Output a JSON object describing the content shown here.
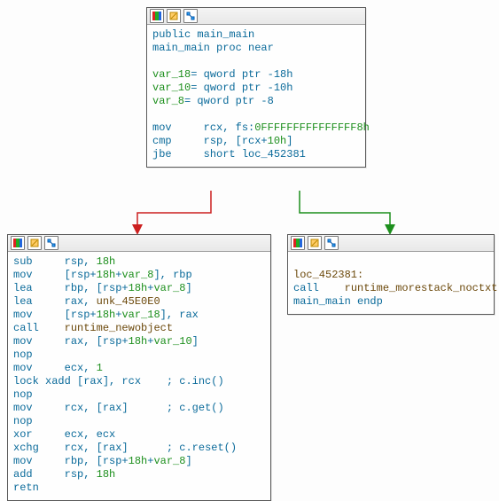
{
  "top_block": {
    "line1_public": "public",
    "line1_name": "main_main",
    "line2_name": "main_main",
    "line2_proc": "proc near",
    "var18_name": "var_18",
    "var18_eq": "= qword ptr -18h",
    "var10_name": "var_10",
    "var10_eq": "= qword ptr -10h",
    "var8_name": "var_8",
    "var8_eq": "= qword ptr -8",
    "mov": "mov",
    "mov_ops_a": "rcx, fs:",
    "mov_ops_b": "0FFFFFFFFFFFFFFF8h",
    "cmp": "cmp",
    "cmp_ops_a": "rsp, [rcx+",
    "cmp_ops_b": "10h",
    "cmp_ops_c": "]",
    "jbe": "jbe",
    "jbe_ops": "short loc_452381"
  },
  "left_block": {
    "l1a": "sub",
    "l1b": "rsp, ",
    "l1c": "18h",
    "l2a": "mov",
    "l2b": "[rsp+",
    "l2c": "18h",
    "l2d": "+",
    "l2e": "var_8",
    "l2f": "], rbp",
    "l3a": "lea",
    "l3b": "rbp, [rsp+",
    "l3c": "18h",
    "l3d": "+",
    "l3e": "var_8",
    "l3f": "]",
    "l4a": "lea",
    "l4b": "rax, ",
    "l4c": "unk_45E0E0",
    "l5a": "mov",
    "l5b": "[rsp+",
    "l5c": "18h",
    "l5d": "+",
    "l5e": "var_18",
    "l5f": "], rax",
    "l6a": "call",
    "l6b": "runtime_newobject",
    "l7a": "mov",
    "l7b": "rax, [rsp+",
    "l7c": "18h",
    "l7d": "+",
    "l7e": "var_10",
    "l7f": "]",
    "l8": "nop",
    "l9a": "mov",
    "l9b": "ecx, ",
    "l9c": "1",
    "l10a": "lock xadd [rax], rcx",
    "l10c": "; c.inc()",
    "l11": "nop",
    "l12a": "mov",
    "l12b": "rcx, [rax]",
    "l12c": "; c.get()",
    "l13": "nop",
    "l14a": "xor",
    "l14b": "ecx, ecx",
    "l15a": "xchg",
    "l15b": "rcx, [rax]",
    "l15c": "; c.reset()",
    "l16a": "mov",
    "l16b": "rbp, [rsp+",
    "l16c": "18h",
    "l16d": "+",
    "l16e": "var_8",
    "l16f": "]",
    "l17a": "add",
    "l17b": "rsp, ",
    "l17c": "18h",
    "l18": "retn"
  },
  "right_block": {
    "label": "loc_452381:",
    "call": "call",
    "callee": "runtime_morestack_noctxt",
    "endp_a": "main_main",
    "endp_b": "endp"
  }
}
